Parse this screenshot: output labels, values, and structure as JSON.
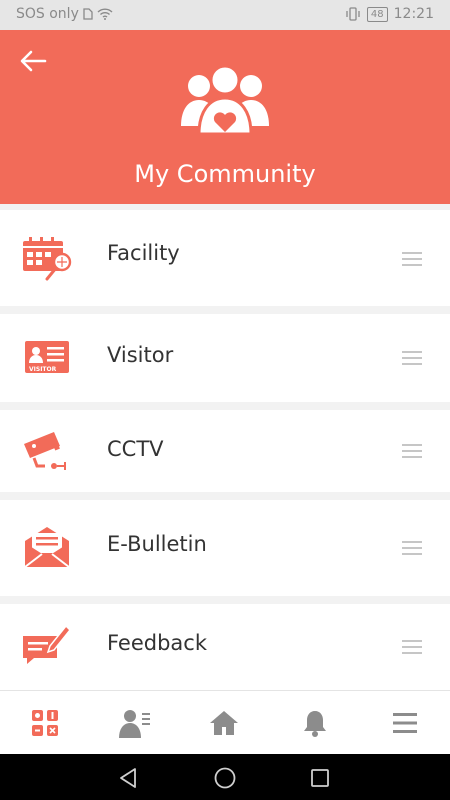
{
  "status_bar": {
    "carrier": "SOS only",
    "battery": "48",
    "time": "12:21"
  },
  "header": {
    "title": "My Community"
  },
  "menu": {
    "items": [
      {
        "label": "Facility",
        "icon": "calendar-racket-icon"
      },
      {
        "label": "Visitor",
        "icon": "visitor-card-icon"
      },
      {
        "label": "CCTV",
        "icon": "cctv-camera-icon"
      },
      {
        "label": "E-Bulletin",
        "icon": "envelope-icon"
      },
      {
        "label": "Feedback",
        "icon": "feedback-pen-icon"
      }
    ],
    "visitor_badge_text": "VISITOR"
  },
  "bottom_nav": {
    "tabs": [
      "community-apps-icon",
      "contact-card-icon",
      "home-icon",
      "bell-icon",
      "menu-icon"
    ]
  },
  "colors": {
    "accent": "#f26b59",
    "nav_icon": "#8c8c8c"
  }
}
